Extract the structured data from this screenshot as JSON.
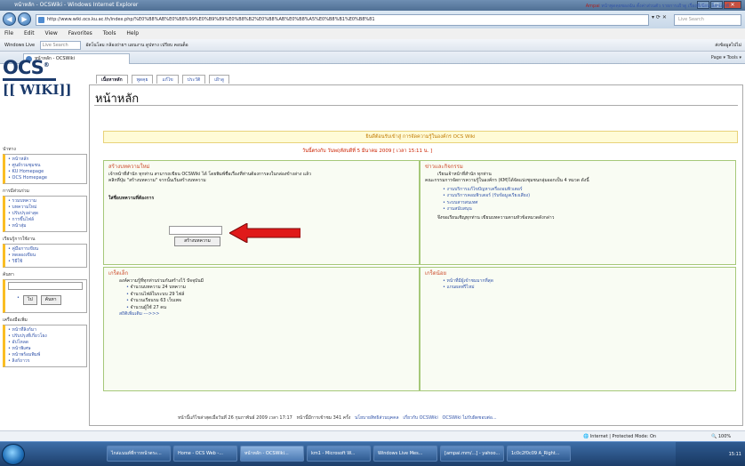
{
  "window": {
    "title": "หน้าหลัก - OCSWiki - Windows Internet Explorer",
    "url": "http://www.wiki.ocs.ku.ac.th/index.php/%E0%B8%AB%E0%B8%99%E0%B9%89%E0%B8%B2%E0%B8%AB%E0%B8%A5%E0%B8%B1%E0%B8%81",
    "search_placeholder": "Live Search"
  },
  "menubar": [
    "File",
    "Edit",
    "View",
    "Favorites",
    "Tools",
    "Help"
  ],
  "linksbar": {
    "windows_live": "Windows Live",
    "live_search": "Live Search",
    "items": "อัตโนโลม  กล้องถ่ายฯ  แผนงาน  ดูปทาง  เปรียบ  คอนต็อ",
    "right": "ส่งข้อมูลไปไม่"
  },
  "tab": {
    "label": "หน้าหลัก - OCSWiki",
    "tools": "Page ▾  Tools ▾"
  },
  "personal": {
    "user": "Ampai",
    "links": "หน้าพูดคุยของฉัน  ตั้งค่าส่วนตัว  รายการเฝ้าดู  เรื่องที่เขียน  ล็อกเอาท์"
  },
  "logo": {
    "ocs": "OCS",
    "wiki": "[[ WIKI]]"
  },
  "page_tabs": [
    "เนื้อหาหลัก",
    "พูดคุย",
    "แก้ไข",
    "ประวัติ",
    "เฝ้าดู"
  ],
  "page_title": "หน้าหลัก",
  "welcome": "ยินดีต้อนรับเข้าสู่ การจัดความรู้ในองค์กร OCS Wiki",
  "date_text": "วันนี้ตรงกับ วันพฤหัสบดีที่ 5 มีนาคม 2009 [ เวลา 15:11 น. ]",
  "sidebar": {
    "nav_heading": "นำทาง",
    "nav": [
      "หน้าหลัก",
      "ศูนย์รวมชุมชน",
      "KU Homepage",
      "OCS Homepage"
    ],
    "part_heading": "การมีส่วนร่วม",
    "part": [
      "รวมบทความ",
      "บทความใหม่",
      "ปรับปรุงล่าสุด",
      "การขึ้นไฟล์",
      "หน้าสุ่ม"
    ],
    "learn_heading": "เรียนรู้การใช้งาน",
    "learn": [
      "คู่มือการเขียน",
      "ทดลองเขียน",
      "วิธีใช้"
    ],
    "search_heading": "ค้นหา",
    "search_go": "ไป",
    "search_find": "ค้นหา",
    "tools_heading": "เครื่องมือเพิ่ม",
    "tools": [
      "หน้าที่ลิงก์มา",
      "ปรับปรุงที่เกี่ยวโยง",
      "อัปโหลด",
      "หน้าพิเศษ",
      "หน้าพร้อมพิมพ์",
      "ลิงก์ถาวร"
    ]
  },
  "box_create": {
    "heading": "สร้างบทความใหม่",
    "text": "เจ้าหน้าที่สำนัก ทุกท่าน สามารถเขียน OCSWiki ได้ โดยพิมพ์ชื่อเรื่องที่ท่านต้องการลงในกล่องข้างล่าง แล้ว คลิกที่ปุ่ม \"สร้างบทความ\" จากนั้นเริ่มสร้างบทความ",
    "label": "ใส่ชื่อบทความที่ต้องการ",
    "button": "สร้างบทความ"
  },
  "box_news": {
    "heading": "ข่าวและกิจกรรม",
    "greeting": "เรียนเจ้าหน้าที่สำนัก ทุกท่าน",
    "intro": "คณะกรรมการจัดการความรู้ในองค์กร (KM)ได้จัดแบ่งชุมชนกลุ่มออกเป็น 4 หมวด ดังนี้",
    "items": [
      "งานบริการแก้ไขปัญหาเครื่องอมพิวเตอร์",
      "งานบริการคอมพิวเตอร์ (รับข้อมูลเรียงเสียง)",
      "ระบบสารสนเทศ",
      "งานสนับสนุน"
    ],
    "footer": "จึงขอเรียนเชิญทุกท่าน เขียนบทความตามหัวข้อหมวดดังกล่าว"
  },
  "box_tips": {
    "heading": "เกร็ดเล็ก",
    "intro": "องค์ความรู้ที่ทุกท่านร่วมกันสร้างไว้ ปัจจุบันมี",
    "items": [
      "จำนวนบทความ 24 บทความ",
      "จำนวนไฟล์ในระบบ 29 ไฟล์",
      "จำนวนเรียนรม 63 เว็บเพจ",
      "จำนวนผู้ใช้ 27 คน"
    ],
    "more": "สถิติเพิ่มเติม --->>>"
  },
  "box_small": {
    "heading": "เกร็ดน้อย",
    "items": [
      "หน้าที่มีผู้เข้าชมมากที่สุด",
      "แกนผลฟรีไหม่"
    ]
  },
  "footer": {
    "modified": "หน้านี้แก้ไขล่าสุดเมื่อวันที่ 26 กุมภาพันธ์ 2009 เวลา 17:17",
    "views": "หน้านี้มีการเข้าชม 341 ครั้ง",
    "links": [
      "นโยบายสิทธิส่วนบุคคล",
      "เกี่ยวกับ OCSWiki",
      "OCSWiki ไม่รับผิดชอบต่อ..."
    ]
  },
  "statusbar": {
    "zone": "Internet | Protected Mode: On",
    "zoom": "100%"
  },
  "taskbar": {
    "buttons": [
      "ไกล่แนนท์ที่การหน้าตระ...",
      "Home - OCS Web -...",
      "หน้าหลัก - OCSWiki...",
      "km1 - Microsoft W...",
      "Windows Live Mes...",
      "[ampai.mm/...] - yahoo...",
      "1c0c2f0c09 A_Right..."
    ],
    "clock": "15:11"
  },
  "colors": {
    "accent": "#3355aa",
    "box_border": "#a6c879",
    "welcome_bg": "#fffbd6",
    "arrow": "#e01a1a"
  }
}
